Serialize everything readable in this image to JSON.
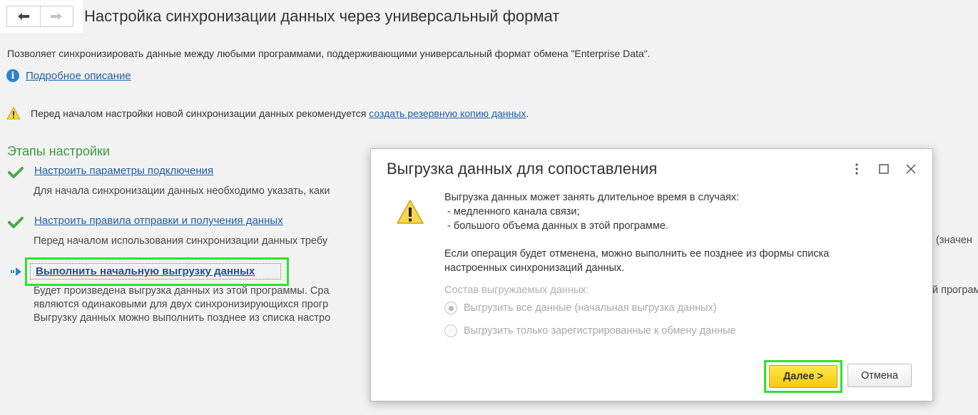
{
  "header": {
    "title": "Настройка синхронизации данных через универсальный формат",
    "back_icon": "arrow-left-icon",
    "forward_icon": "arrow-right-icon"
  },
  "main": {
    "description": "Позволяет синхронизировать данные между любыми программами, поддерживающими универсальный формат обмена \"Enterprise Data\".",
    "info_link": "Подробное описание",
    "warning_text": "Перед началом настройки новой синхронизации данных рекомендуется ",
    "warning_link": "создать резервную копию данных",
    "warning_end": ".",
    "stages_title": "Этапы настройки",
    "stages": [
      {
        "link": "Настроить параметры подключения",
        "desc": "Для начала синхронизации данных необходимо указать, каки",
        "status": "done"
      },
      {
        "link": "Настроить правила отправки и получения данных",
        "desc": "Перед началом использования синхронизации данных требу",
        "desc_right": "(значен",
        "status": "done"
      },
      {
        "link": "Выполнить начальную выгрузку данных",
        "desc_lines": [
          "Будет произведена выгрузка данных из этой программы. Сра",
          "являются одинаковыми для двух синхронизирующихся прогр",
          "Выгрузку данных можно выполнить позднее из списка настро"
        ],
        "desc_right": "й програм",
        "status": "current"
      }
    ]
  },
  "dialog": {
    "title": "Выгрузка данных для сопоставления",
    "message_lines": [
      "Выгрузка данных может занять длительное время в случаях:",
      " - медленного канала связи;",
      " - большого объема данных в этой программе."
    ],
    "message2_lines": [
      "Если операция будет отменена, можно выполнить ее позднее из формы списка",
      "настроенных синхронизаций данных."
    ],
    "section_label": "Состав выгружаемых данных:",
    "radio_options": [
      {
        "label": "Выгрузить все данные (начальная выгрузка данных)",
        "selected": true
      },
      {
        "label": "Выгрузить только зарегистрированные к обмену данные",
        "selected": false
      }
    ],
    "next_button": "Далее >",
    "cancel_button": "Отмена"
  },
  "colors": {
    "accent_green": "#3a9a3e",
    "link_blue": "#1e5ea8",
    "highlight": "#2ee22e",
    "primary_button": "#f5cb10"
  }
}
